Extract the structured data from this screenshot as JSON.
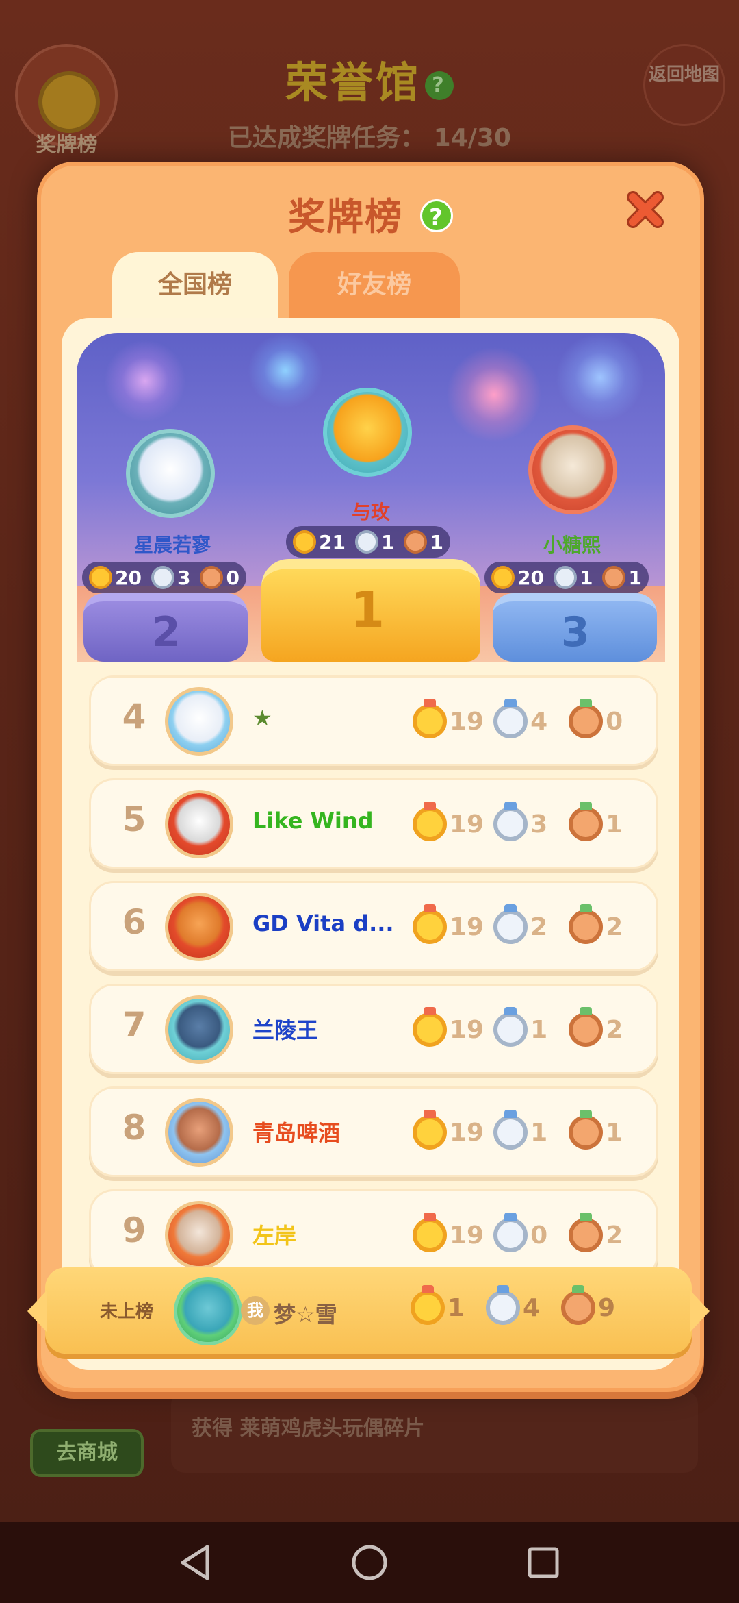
{
  "background": {
    "hall_title": "荣誉馆",
    "progress_label": "已达成奖牌任务：",
    "progress_value": "14/30",
    "medal_board_label": "奖牌榜",
    "back_map_label": "返回地图",
    "shop_button": "去商城",
    "reward_text": "获得 莱萌鸡虎头玩偶碎片"
  },
  "modal": {
    "title": "奖牌榜",
    "help_icon": "?",
    "tabs": [
      "全国榜",
      "好友榜"
    ]
  },
  "top3": [
    {
      "rank": "1",
      "name": "与玫",
      "name_color": "#e0412c",
      "gold": "21",
      "silver": "1",
      "bronze": "1"
    },
    {
      "rank": "2",
      "name": "星晨若寥",
      "name_color": "#2f57c9",
      "gold": "20",
      "silver": "3",
      "bronze": "0"
    },
    {
      "rank": "3",
      "name": "小糖熙",
      "name_color": "#4da82b",
      "gold": "20",
      "silver": "1",
      "bronze": "1"
    }
  ],
  "rows": [
    {
      "rank": "4",
      "name": "★",
      "name_color": "#5b8b2e",
      "gold": "19",
      "silver": "4",
      "bronze": "0"
    },
    {
      "rank": "5",
      "name": "Like  Wind",
      "name_color": "#35b51f",
      "gold": "19",
      "silver": "3",
      "bronze": "1"
    },
    {
      "rank": "6",
      "name": "GD Vita d...",
      "name_color": "#1b3fc4",
      "gold": "19",
      "silver": "2",
      "bronze": "2"
    },
    {
      "rank": "7",
      "name": "兰陵王",
      "name_color": "#1f44c9",
      "gold": "19",
      "silver": "1",
      "bronze": "2"
    },
    {
      "rank": "8",
      "name": "青岛啤酒",
      "name_color": "#e74d1f",
      "gold": "19",
      "silver": "1",
      "bronze": "1"
    },
    {
      "rank": "9",
      "name": "左岸",
      "name_color": "#f2c419",
      "gold": "19",
      "silver": "0",
      "bronze": "2"
    }
  ],
  "me": {
    "status": "未上榜",
    "badge": "我",
    "name": "梦☆雪",
    "gold": "1",
    "silver": "4",
    "bronze": "9"
  },
  "colors": {
    "modal_bg": "#fbb572",
    "title": "#c8572b",
    "close": "#e5552f",
    "help": "#62c52b"
  },
  "icons": {
    "close": "close-icon",
    "help": "help-icon",
    "gold": "gold-medal-icon",
    "silver": "silver-medal-icon",
    "bronze": "bronze-medal-icon",
    "nav_back": "back-triangle-icon",
    "nav_home": "home-circle-icon",
    "nav_recent": "recent-square-icon"
  }
}
